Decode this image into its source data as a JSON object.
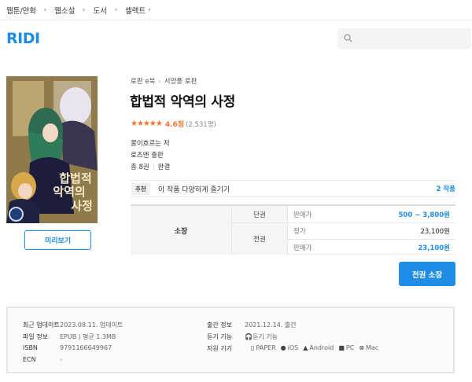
{
  "topnav": {
    "items": [
      "웹툰/만화",
      "웹소설",
      "도서",
      "셀렉트"
    ],
    "select_chevron": "›"
  },
  "header": {
    "logo": "RIDI",
    "search_icon": "search-icon"
  },
  "book": {
    "breadcrumb": [
      "로판 e북",
      "서양풍 로판"
    ],
    "breadcrumb_sep": "›",
    "title": "합법적 악역의 사정",
    "stars": "★★★★★",
    "rating": "4.6점",
    "rating_count": "(2,531명)",
    "author": "꿀이흐르는 저",
    "publisher": "로즈엔 출판",
    "volumes": "총 8권",
    "status": "완결",
    "preview_label": "미리보기",
    "cover_title": "합법적 악역의 사정"
  },
  "recommend": {
    "tag": "추천",
    "text": "이 작품 다양하게 즐기기",
    "count": "2 작품"
  },
  "pricing": {
    "own_label": "소장",
    "single_label": "단권",
    "single_price_label": "판매가",
    "single_price": "500 ~ 3,800원",
    "full_label": "전권",
    "list_price_label": "정가",
    "list_price": "23,100원",
    "sale_price_label": "판매가",
    "sale_price": "23,100원",
    "buy_label": "전권 소장"
  },
  "info": {
    "updated_label": "최근 업데이트",
    "updated_value": "2023.08.11. 업데이트",
    "file_label": "파일 정보",
    "file_value": "EPUB | 평균 1.3MB",
    "isbn_label": "ISBN",
    "isbn_value": "9791166649967",
    "ecn_label": "ECN",
    "ecn_value": "-",
    "pub_label": "출간 정보",
    "pub_value": "2021.12.14. 출간",
    "listen_label": "듣기 기능",
    "listen_value": "듣기 기능",
    "device_label": "지원 기기",
    "devices": [
      {
        "icon": "paper-icon",
        "glyph": "▯",
        "label": "PAPER"
      },
      {
        "icon": "apple-icon",
        "glyph": "●",
        "label": "iOS"
      },
      {
        "icon": "android-icon",
        "glyph": "▲",
        "label": "Android"
      },
      {
        "icon": "windows-icon",
        "glyph": "■",
        "label": "PC"
      },
      {
        "icon": "mac-icon",
        "glyph": "⊗",
        "label": "Mac"
      }
    ]
  },
  "colors": {
    "brand": "#1f8ce6",
    "rating": "#fa722e"
  }
}
